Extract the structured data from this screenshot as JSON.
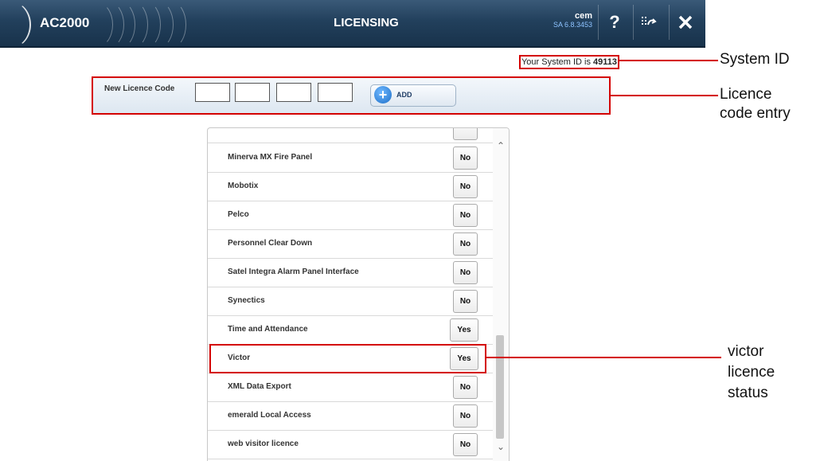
{
  "header": {
    "app_name": "AC2000",
    "title": "LICENSING",
    "user": "cem",
    "version": "SA 6.8.3453",
    "help_icon": "question-mark-icon",
    "exit_icon": "exit-arrow-icon",
    "close_icon": "close-icon"
  },
  "system_id": {
    "prefix": "Your System ID is",
    "value": "49113"
  },
  "licence_entry": {
    "label": "New Licence Code",
    "add_label": "ADD"
  },
  "licences": [
    {
      "name": "Minerva MX Fire Panel",
      "status": "No"
    },
    {
      "name": "Mobotix",
      "status": "No"
    },
    {
      "name": "Pelco",
      "status": "No"
    },
    {
      "name": "Personnel Clear Down",
      "status": "No"
    },
    {
      "name": "Satel Integra Alarm Panel Interface",
      "status": "No"
    },
    {
      "name": "Synectics",
      "status": "No"
    },
    {
      "name": "Time and Attendance",
      "status": "Yes"
    },
    {
      "name": "Victor",
      "status": "Yes"
    },
    {
      "name": "XML Data Export",
      "status": "No"
    },
    {
      "name": "emerald Local Access",
      "status": "No"
    },
    {
      "name": "web visitor licence",
      "status": "No"
    }
  ],
  "callouts": {
    "system_id": "System ID",
    "licence_entry_1": "Licence",
    "licence_entry_2": "code entry",
    "victor_1": "victor",
    "victor_2": "licence",
    "victor_3": "status"
  },
  "colors": {
    "highlight": "#d40000",
    "header_bg": "#22405c"
  }
}
